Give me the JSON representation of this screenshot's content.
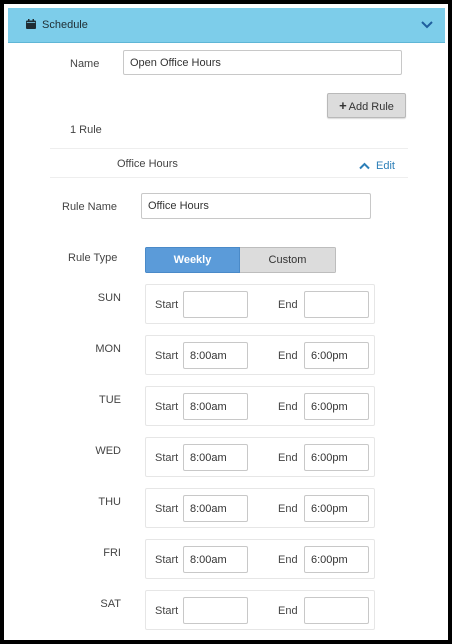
{
  "header": {
    "title": "Schedule",
    "icon": "calendar-icon",
    "toggle_icon": "chevron-down-icon",
    "color": "#7dcdea"
  },
  "name_field": {
    "label": "Name",
    "value": "Open Office Hours"
  },
  "add_rule": {
    "label": "Add Rule"
  },
  "rule_count": "1 Rule",
  "rule": {
    "title": "Office Hours",
    "edit_label": "Edit",
    "rule_name_label": "Rule Name",
    "rule_name_value": "Office Hours",
    "rule_type_label": "Rule Type",
    "rule_type_options": [
      "Weekly",
      "Custom"
    ],
    "rule_type_selected": "Weekly",
    "accent": "#5b9bd9"
  },
  "start_label": "Start",
  "end_label": "End",
  "days": [
    {
      "name": "SUN",
      "start": "",
      "end": ""
    },
    {
      "name": "MON",
      "start": "8:00am",
      "end": "6:00pm"
    },
    {
      "name": "TUE",
      "start": "8:00am",
      "end": "6:00pm"
    },
    {
      "name": "WED",
      "start": "8:00am",
      "end": "6:00pm"
    },
    {
      "name": "THU",
      "start": "8:00am",
      "end": "6:00pm"
    },
    {
      "name": "FRI",
      "start": "8:00am",
      "end": "6:00pm"
    },
    {
      "name": "SAT",
      "start": "",
      "end": ""
    }
  ]
}
